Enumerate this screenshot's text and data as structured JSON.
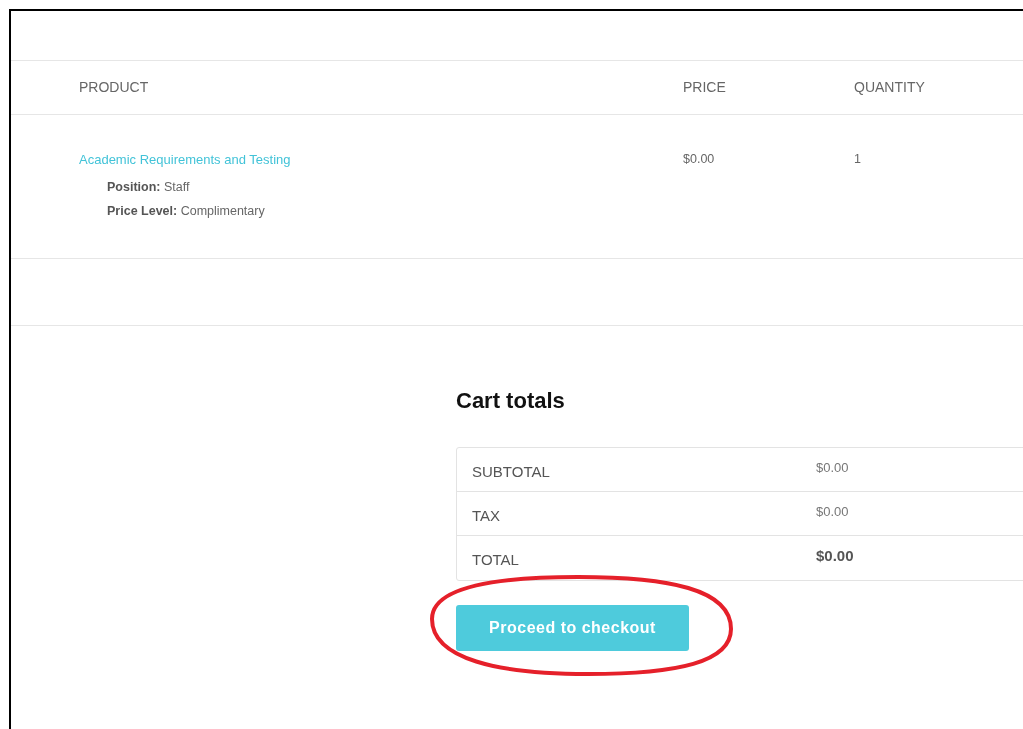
{
  "cart_table": {
    "columns": [
      "PRODUCT",
      "PRICE",
      "QUANTITY"
    ],
    "rows": [
      {
        "product": "Academic Requirements and Testing",
        "details": [
          "**Position:** Staff",
          "**Price Level:** Complimentary"
        ],
        "price": "$0.00",
        "quantity": "1"
      }
    ]
  },
  "cart_totals": {
    "title": "Cart totals",
    "rows": [
      {
        "kind": "line",
        "label": "SUBTOTAL",
        "value": "$0.00"
      },
      {
        "kind": "line",
        "label": "TAX",
        "value": "$0.00"
      },
      {
        "kind": "total",
        "label": "TOTAL",
        "value": "$0.00"
      }
    ],
    "button": "Proceed to checkout"
  }
}
